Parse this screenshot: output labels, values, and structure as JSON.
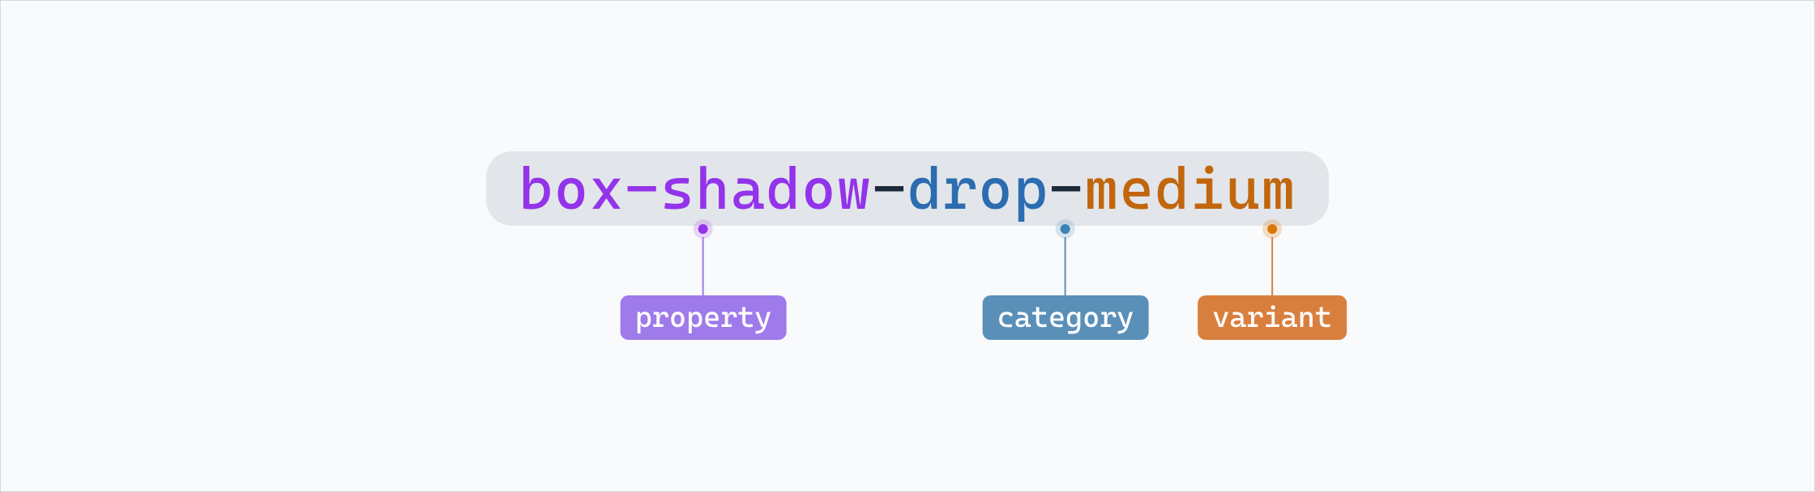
{
  "token": {
    "property": "box-shadow",
    "category": "drop",
    "variant": "medium",
    "separator": "-"
  },
  "annotations": {
    "property_label": "property",
    "category_label": "category",
    "variant_label": "variant"
  }
}
